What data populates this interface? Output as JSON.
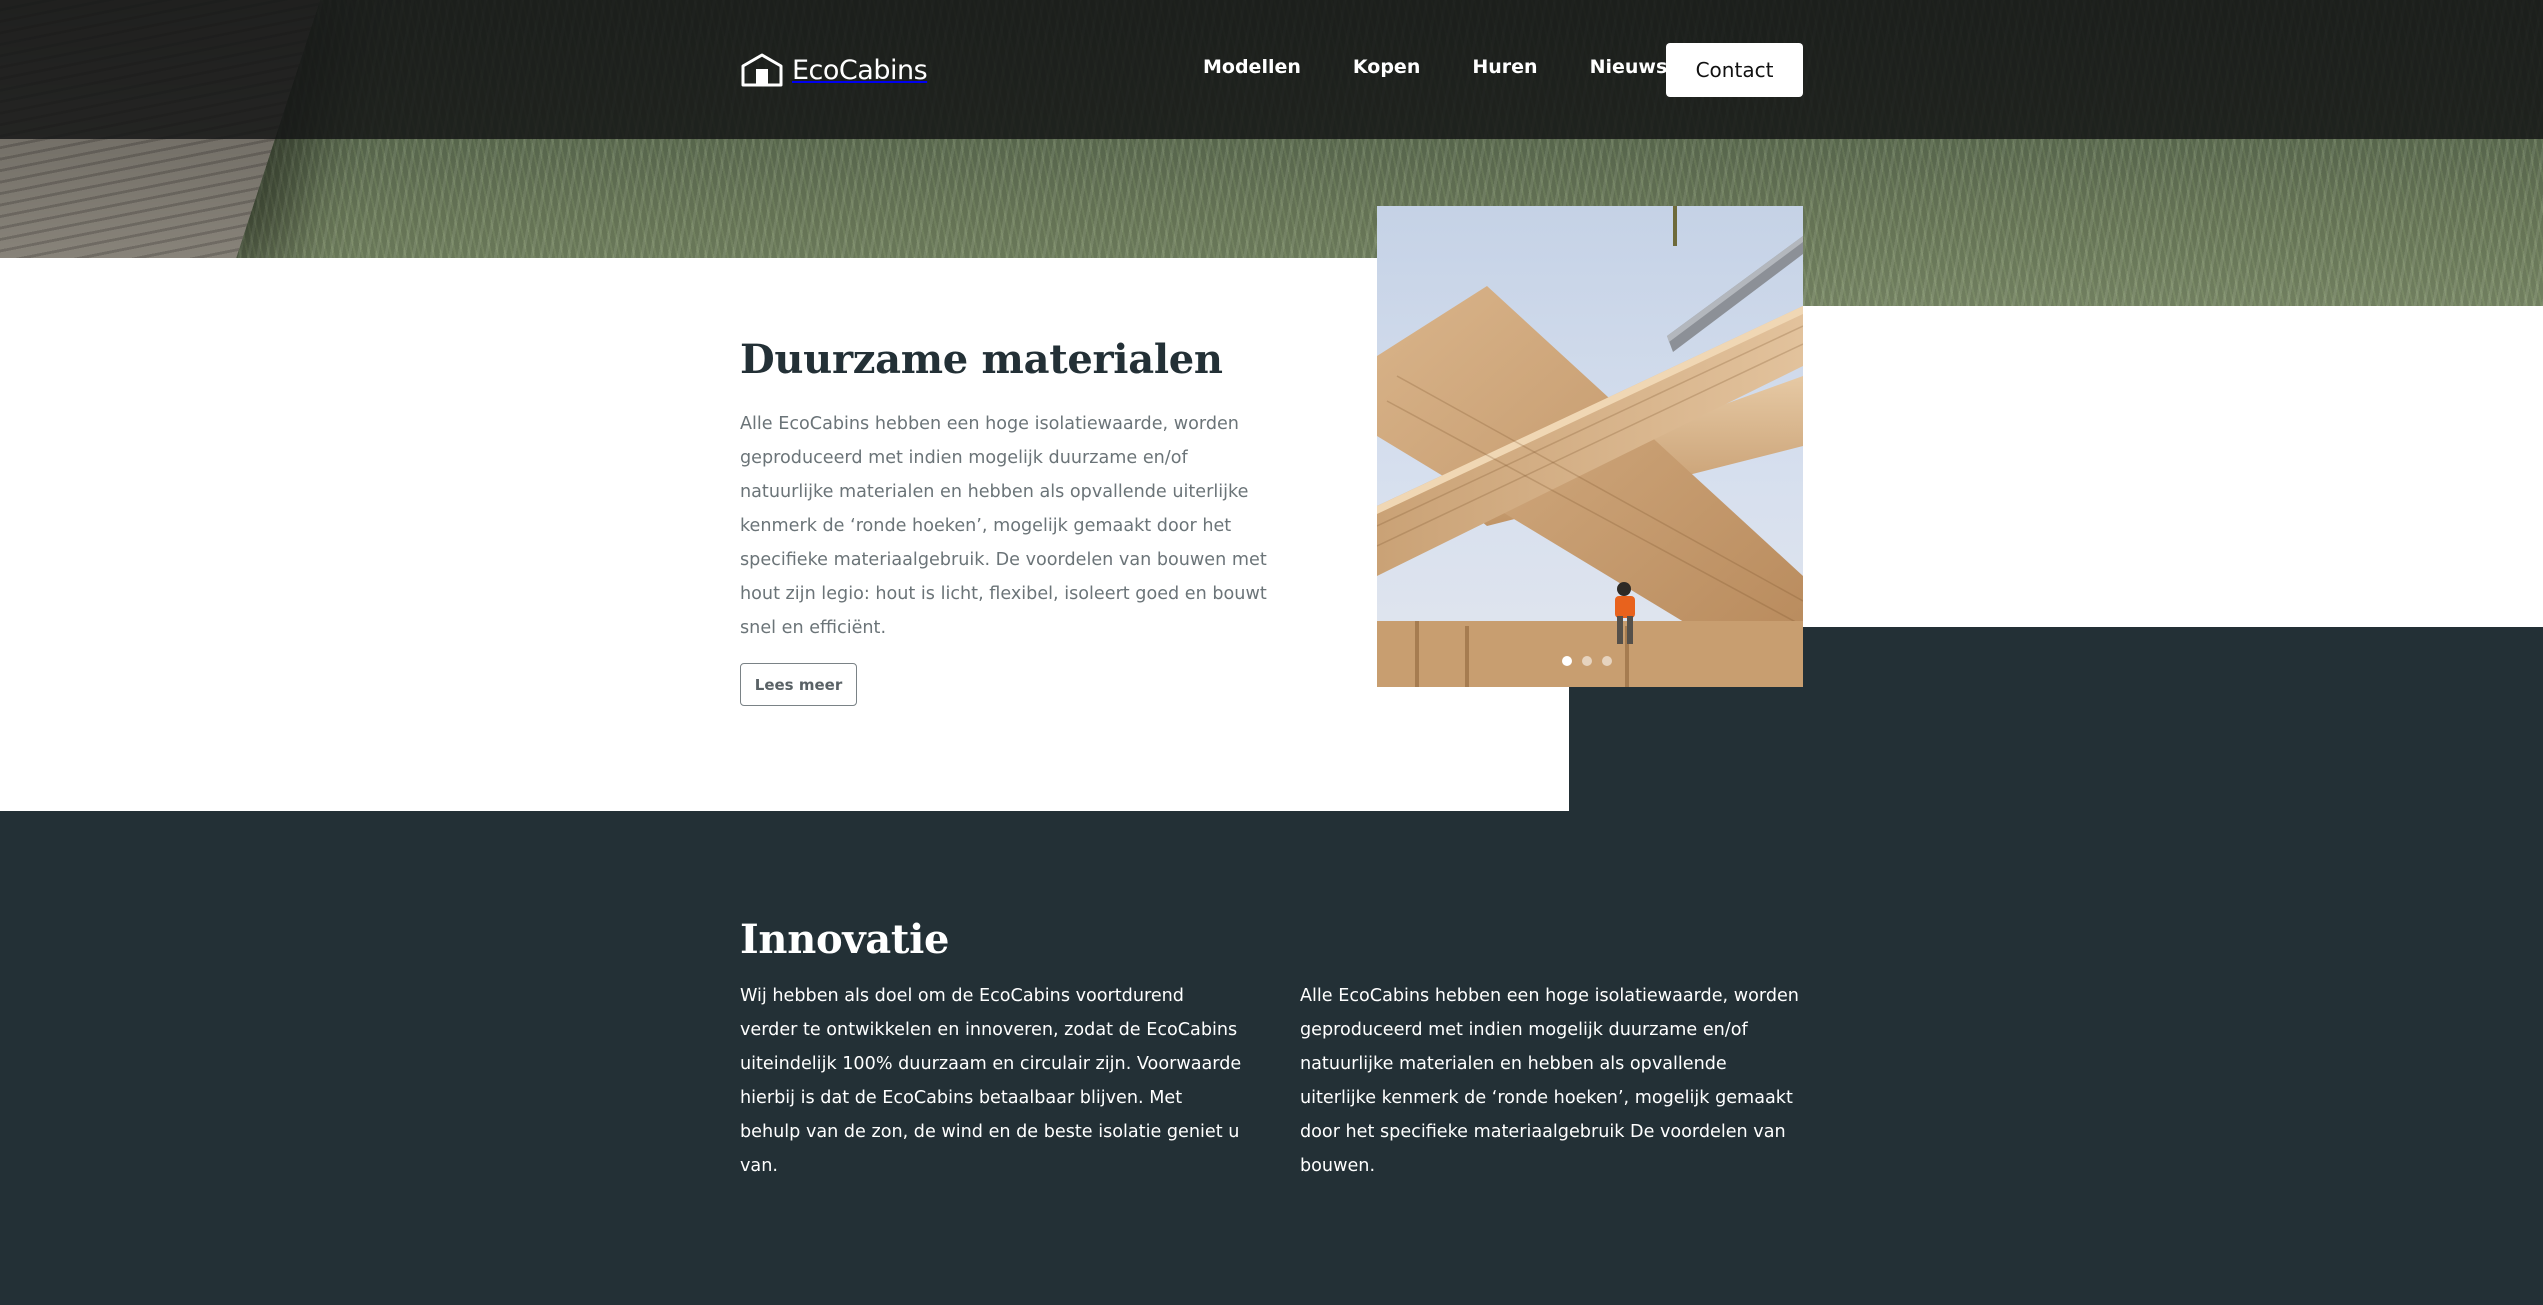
{
  "brand": {
    "name": "EcoCabins",
    "logo_icon": "house-icon"
  },
  "nav": {
    "items": [
      {
        "label": "Modellen"
      },
      {
        "label": "Kopen"
      },
      {
        "label": "Huren"
      },
      {
        "label": "Nieuws"
      }
    ],
    "contact_label": "Contact"
  },
  "materials": {
    "title": "Duurzame materialen",
    "body": "Alle EcoCabins hebben een hoge isolatiewaarde, worden geproduceerd met indien mogelijk duurzame en/of natuurlijke materialen en hebben als opvallende uiterlijke kenmerk de ‘ronde hoeken’, mogelijk gemaakt door het specifieke materiaalgebruik. De voordelen van bouwen met hout zijn legio: hout is licht, flexibel, isoleert goed en bouwt snel en efficiënt.",
    "button_label": "Lees meer"
  },
  "slider": {
    "image_icon": "timber-construction-photo",
    "slide_count": 3,
    "active_slide": 1
  },
  "innovation": {
    "title": "Innovatie",
    "col_left": "Wij hebben als doel om de EcoCabins voortdurend verder te ontwikkelen en innoveren, zodat de EcoCabins uiteindelijk 100% duurzaam en circulair zijn. Voorwaarde hierbij is dat de EcoCabins betaalbaar blijven. Met behulp van de zon, de wind en de beste isolatie geniet u van.",
    "col_right": "Alle EcoCabins hebben een hoge isolatiewaarde, worden geproduceerd met indien mogelijk duurzame en/of natuurlijke materialen en hebben als opvallende uiterlijke kenmerk de ‘ronde hoeken’, mogelijk gemaakt door het specifieke materiaalgebruik De voordelen van bouwen."
  },
  "colors": {
    "dark": "#233036",
    "white": "#ffffff",
    "body_text": "#6b7478"
  }
}
